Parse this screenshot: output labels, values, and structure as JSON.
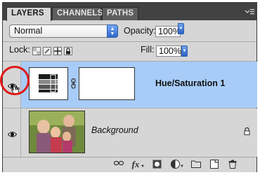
{
  "tabs": [
    {
      "label": "LAYERS",
      "active": true
    },
    {
      "label": "CHANNELS",
      "active": false
    },
    {
      "label": "PATHS",
      "active": false
    }
  ],
  "blend_mode": "Normal",
  "opacity": {
    "label": "Opacity:",
    "value": "100%"
  },
  "lock": {
    "label": "Lock:"
  },
  "fill": {
    "label": "Fill:",
    "value": "100%"
  },
  "layers": [
    {
      "name": "Hue/Saturation 1",
      "selected": true,
      "visible": true,
      "type": "adjustment"
    },
    {
      "name": "Background",
      "selected": false,
      "visible": true,
      "type": "image",
      "locked": true
    }
  ],
  "icons": {
    "panel_menu": "panel-menu-icon",
    "lock_transparent": "lock-transparent-pixels-icon",
    "lock_image": "lock-image-pixels-icon",
    "lock_position": "lock-position-icon",
    "lock_all": "lock-all-icon",
    "eye": "eye-icon",
    "chain": "chain-icon",
    "bottom": [
      "link-layers-icon",
      "fx-icon",
      "add-mask-icon",
      "adjustment-layer-icon",
      "folder-icon",
      "new-layer-icon",
      "trash-icon"
    ]
  },
  "colors": {
    "selected_row": "#a8ccf8",
    "tab_bar": "#424242",
    "highlight_circle": "#e01818"
  }
}
